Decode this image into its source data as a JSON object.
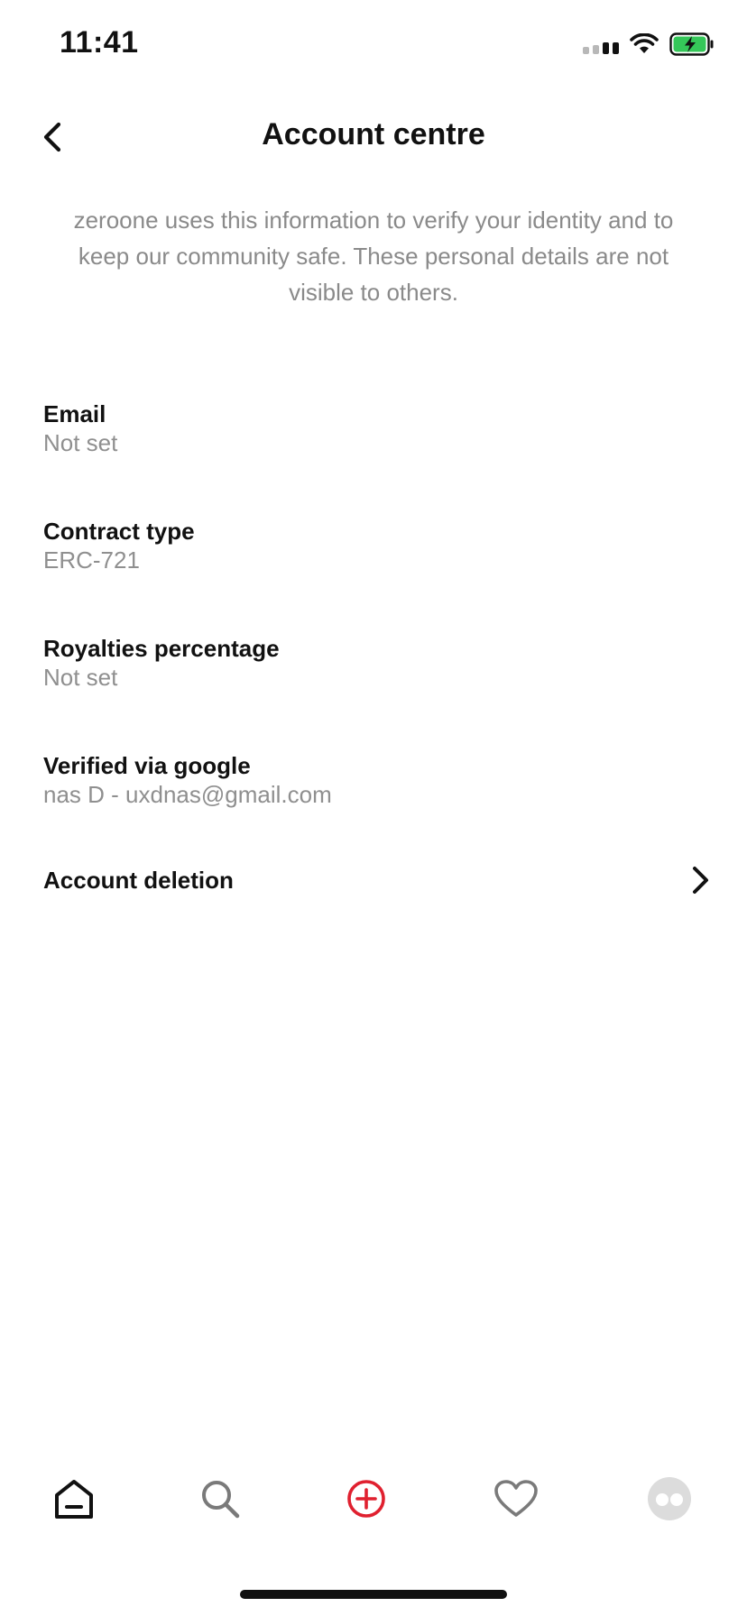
{
  "status_bar": {
    "time": "11:41"
  },
  "header": {
    "title": "Account centre",
    "back_icon": "chevron-left-icon"
  },
  "intro_text": "zeroone uses this information to verify your identity and to keep our community safe. These personal details are not visible to others.",
  "fields": {
    "email": {
      "label": "Email",
      "value": "Not set"
    },
    "contract_type": {
      "label": "Contract type",
      "value": "ERC-721"
    },
    "royalties": {
      "label": "Royalties percentage",
      "value": "Not set"
    },
    "verified": {
      "label": "Verified via google",
      "value": "nas D - uxdnas@gmail.com"
    }
  },
  "account_deletion": {
    "label": "Account deletion",
    "icon": "chevron-right-icon"
  },
  "tab_bar": {
    "tabs": [
      {
        "name": "home",
        "icon": "home-icon"
      },
      {
        "name": "search",
        "icon": "search-icon"
      },
      {
        "name": "create",
        "icon": "plus-circle-icon"
      },
      {
        "name": "favorites",
        "icon": "heart-icon"
      },
      {
        "name": "profile",
        "icon": "avatar-icon"
      }
    ]
  },
  "colors": {
    "accent": "#e0202f",
    "battery_green": "#35c759",
    "text_primary": "#111111",
    "text_secondary": "#8f8f8f"
  }
}
